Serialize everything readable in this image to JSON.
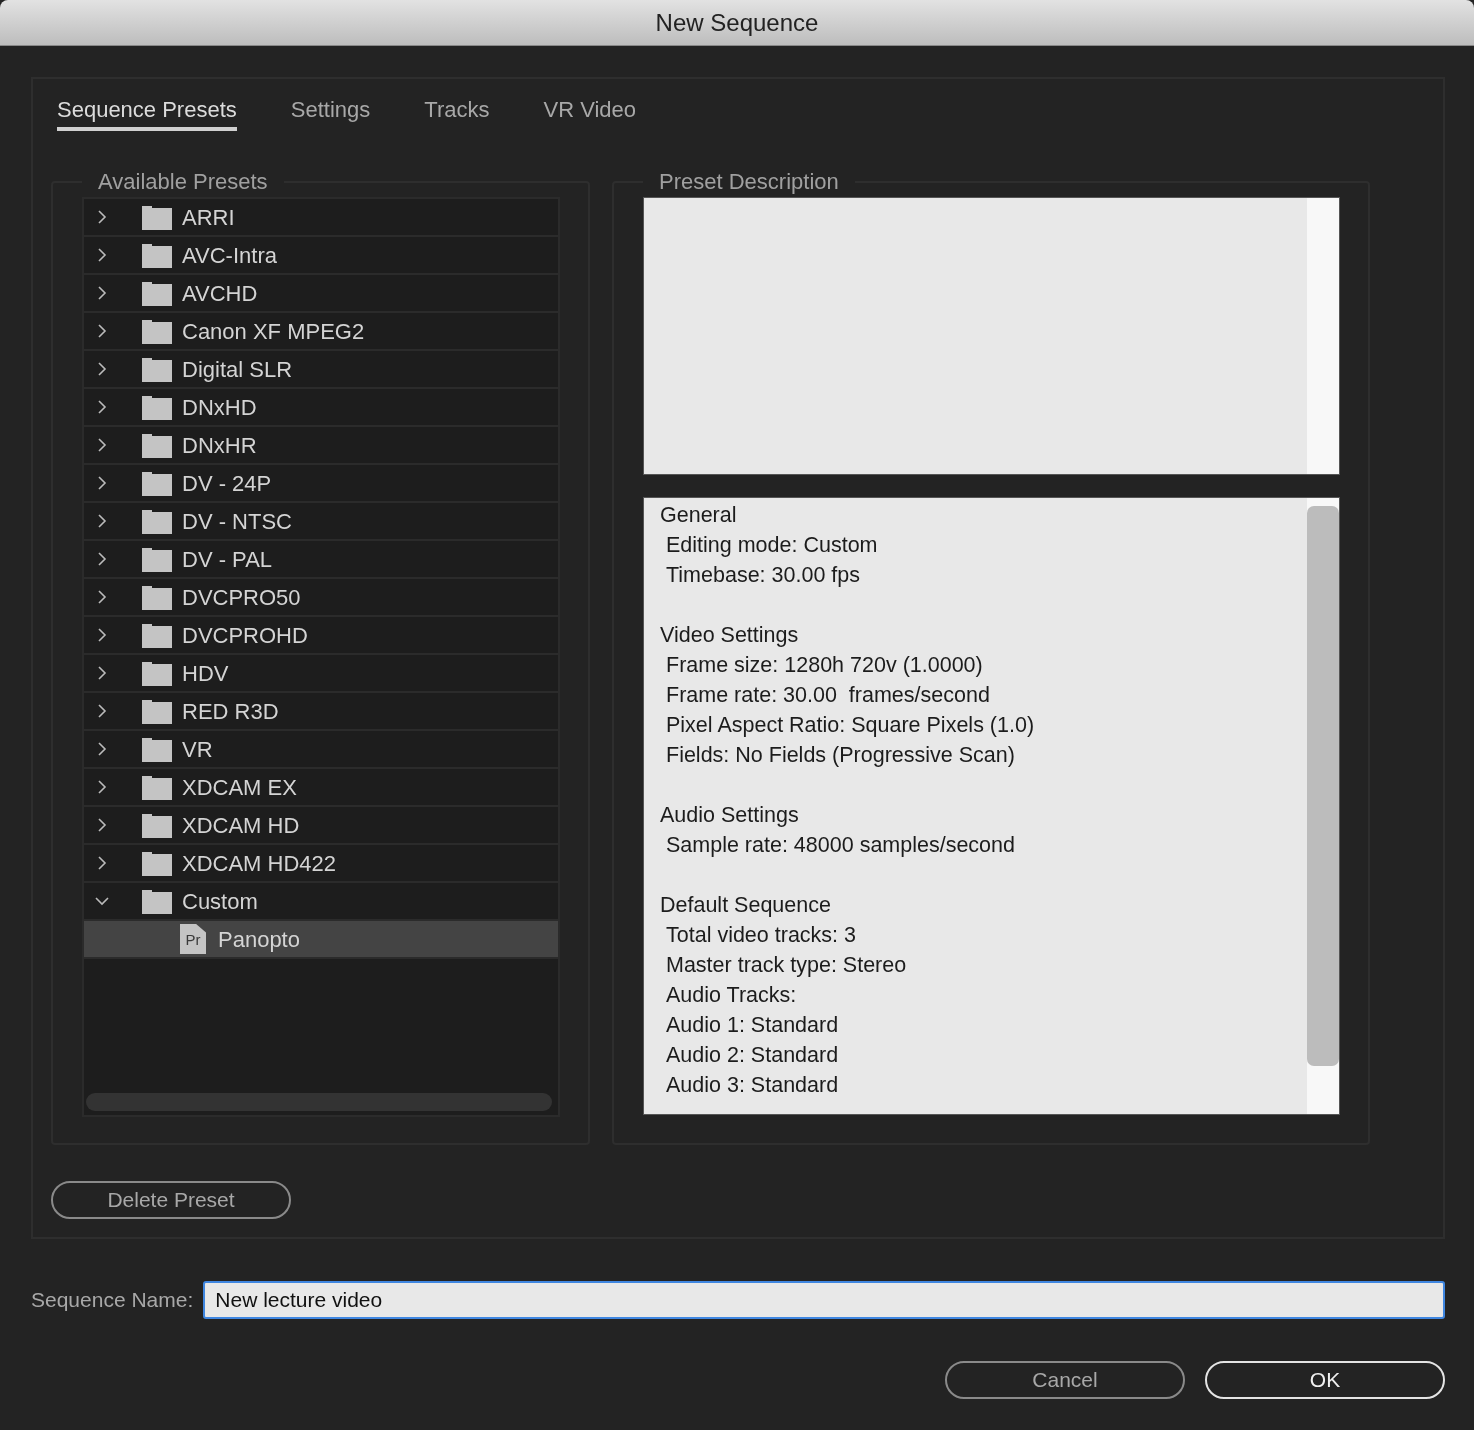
{
  "window": {
    "title": "New Sequence"
  },
  "tabs": [
    {
      "label": "Sequence Presets",
      "selected": true
    },
    {
      "label": "Settings",
      "selected": false
    },
    {
      "label": "Tracks",
      "selected": false
    },
    {
      "label": "VR Video",
      "selected": false
    }
  ],
  "available_presets": {
    "title": "Available Presets",
    "items": [
      {
        "kind": "folder",
        "name": "ARRI",
        "expanded": false,
        "selected": false
      },
      {
        "kind": "folder",
        "name": "AVC-Intra",
        "expanded": false,
        "selected": false
      },
      {
        "kind": "folder",
        "name": "AVCHD",
        "expanded": false,
        "selected": false
      },
      {
        "kind": "folder",
        "name": "Canon XF MPEG2",
        "expanded": false,
        "selected": false
      },
      {
        "kind": "folder",
        "name": "Digital SLR",
        "expanded": false,
        "selected": false
      },
      {
        "kind": "folder",
        "name": "DNxHD",
        "expanded": false,
        "selected": false
      },
      {
        "kind": "folder",
        "name": "DNxHR",
        "expanded": false,
        "selected": false
      },
      {
        "kind": "folder",
        "name": "DV - 24P",
        "expanded": false,
        "selected": false
      },
      {
        "kind": "folder",
        "name": "DV - NTSC",
        "expanded": false,
        "selected": false
      },
      {
        "kind": "folder",
        "name": "DV - PAL",
        "expanded": false,
        "selected": false
      },
      {
        "kind": "folder",
        "name": "DVCPRO50",
        "expanded": false,
        "selected": false
      },
      {
        "kind": "folder",
        "name": "DVCPROHD",
        "expanded": false,
        "selected": false
      },
      {
        "kind": "folder",
        "name": "HDV",
        "expanded": false,
        "selected": false
      },
      {
        "kind": "folder",
        "name": "RED R3D",
        "expanded": false,
        "selected": false
      },
      {
        "kind": "folder",
        "name": "VR",
        "expanded": false,
        "selected": false
      },
      {
        "kind": "folder",
        "name": "XDCAM EX",
        "expanded": false,
        "selected": false
      },
      {
        "kind": "folder",
        "name": "XDCAM HD",
        "expanded": false,
        "selected": false
      },
      {
        "kind": "folder",
        "name": "XDCAM HD422",
        "expanded": false,
        "selected": false
      },
      {
        "kind": "folder",
        "name": "Custom",
        "expanded": true,
        "selected": false,
        "children": [
          {
            "kind": "preset",
            "name": "Panopto",
            "icon_text": "Pr",
            "selected": true
          }
        ]
      }
    ]
  },
  "preset_description": {
    "title": "Preset Description",
    "sections": [
      {
        "heading": "General",
        "lines": [
          "Editing mode: Custom",
          "Timebase: 30.00 fps"
        ]
      },
      {
        "heading": "Video Settings",
        "lines": [
          "Frame size: 1280h 720v (1.0000)",
          "Frame rate: 30.00  frames/second",
          "Pixel Aspect Ratio: Square Pixels (1.0)",
          "Fields: No Fields (Progressive Scan)"
        ]
      },
      {
        "heading": "Audio Settings",
        "lines": [
          "Sample rate: 48000 samples/second"
        ]
      },
      {
        "heading": "Default Sequence",
        "lines": [
          "Total video tracks: 3",
          "Master track type: Stereo",
          "Audio Tracks:",
          "Audio 1: Standard",
          "Audio 2: Standard",
          "Audio 3: Standard"
        ]
      }
    ]
  },
  "delete_button": "Delete Preset",
  "sequence_name": {
    "label": "Sequence Name:",
    "value": "New lecture video"
  },
  "buttons": [
    {
      "label": "Cancel",
      "default": false
    },
    {
      "label": "OK",
      "default": true
    }
  ]
}
